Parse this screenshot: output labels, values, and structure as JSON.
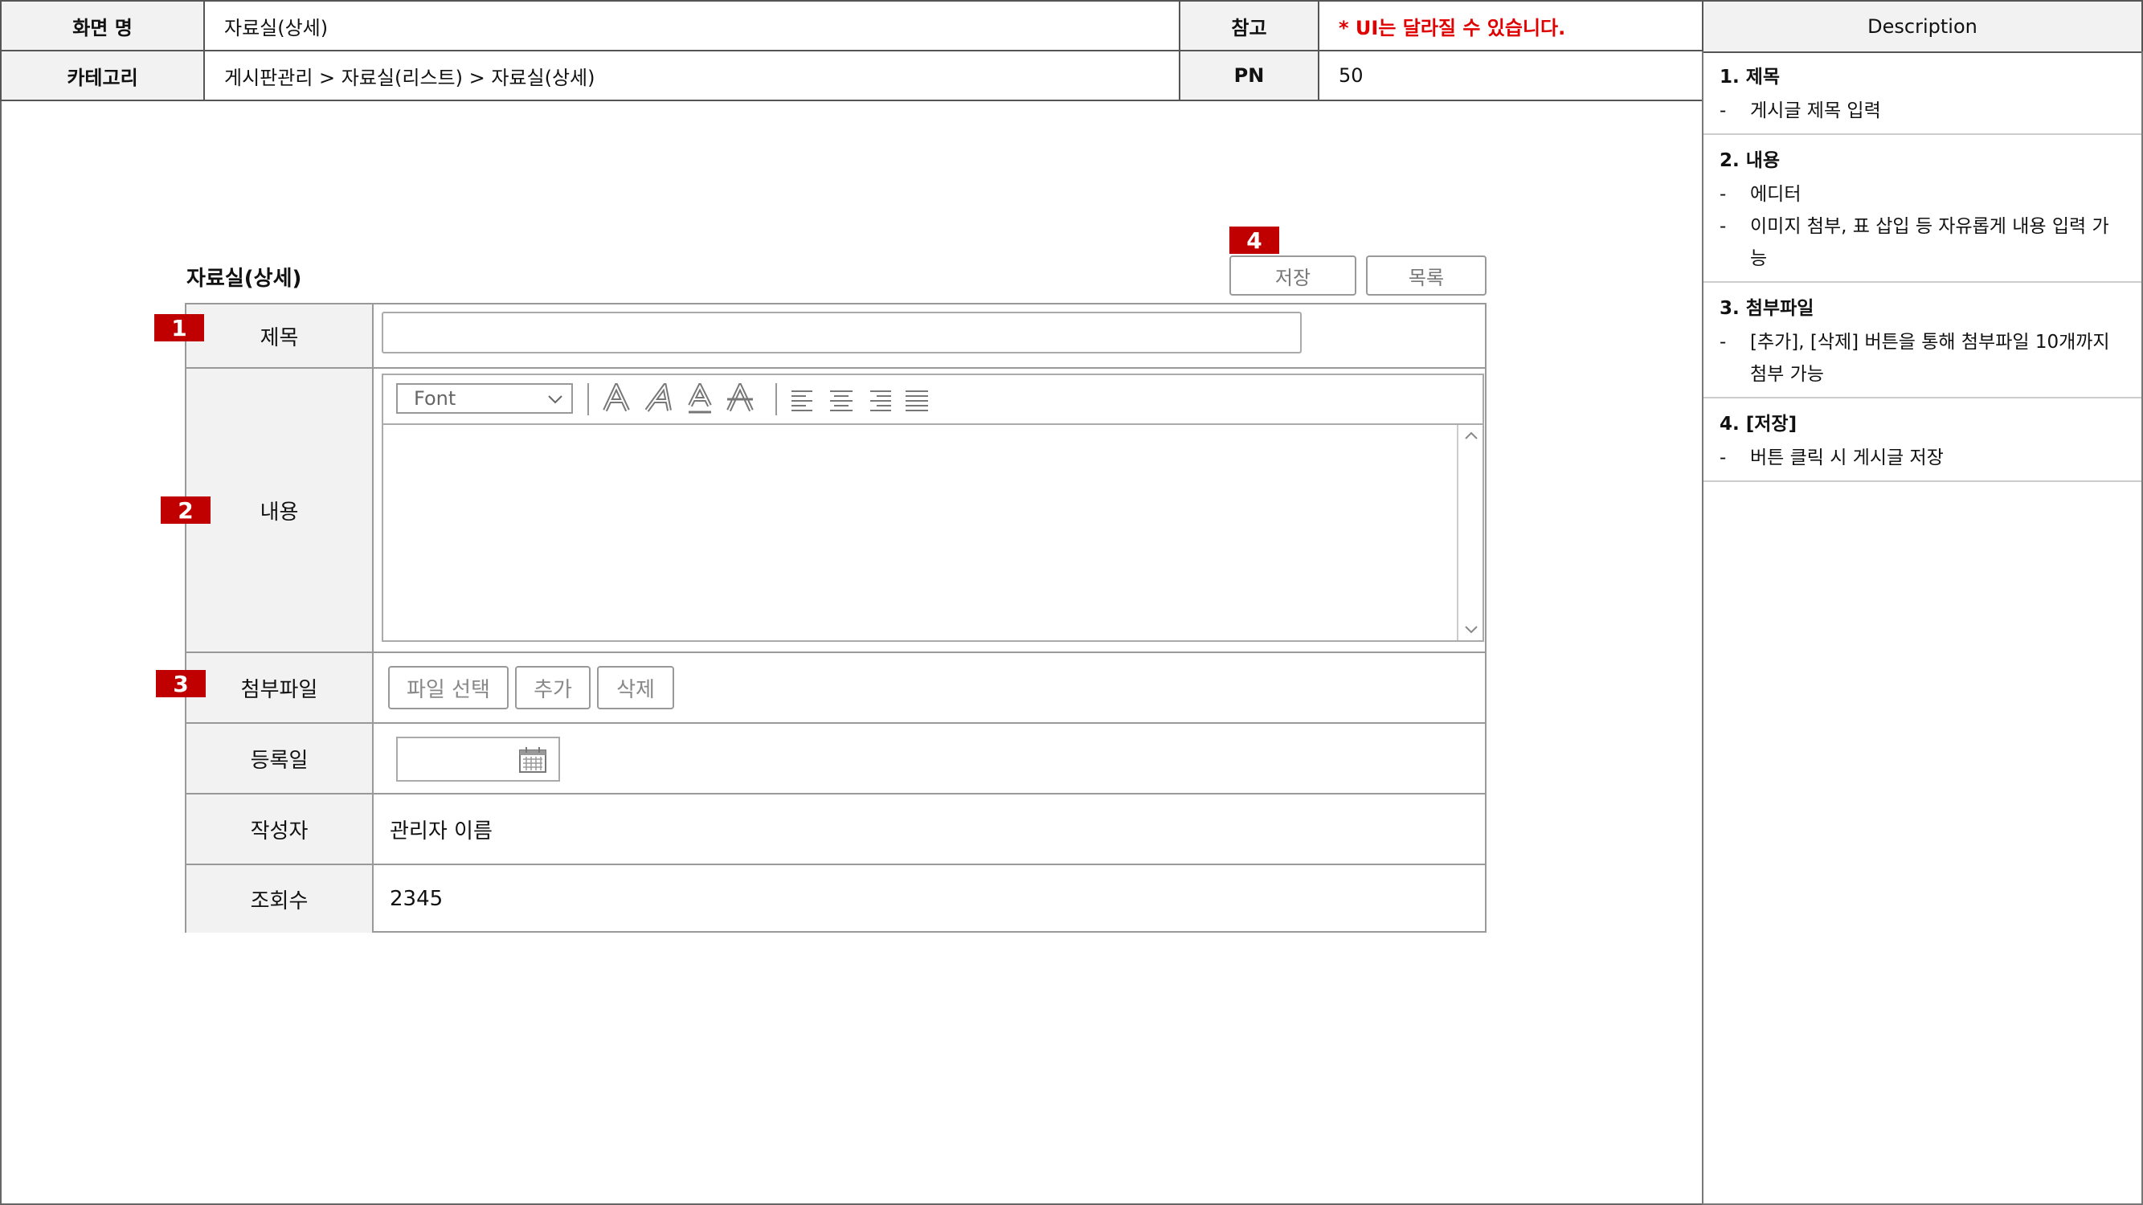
{
  "header": {
    "screen_name_label": "화면 명",
    "screen_name": "자료실(상세)",
    "ref_label": "참고",
    "ref_note": "* UI는 달라질 수 있습니다.",
    "category_label": "카테고리",
    "category": "게시판관리 > 자료실(리스트) > 자료실(상세)",
    "pn_label": "PN",
    "pn": "50"
  },
  "description": {
    "title": "Description",
    "items": [
      {
        "title": "1. 제목",
        "lines": [
          "게시글 제목 입력"
        ]
      },
      {
        "title": "2. 내용",
        "lines": [
          "에디터",
          "이미지 첨부, 표 삽입 등 자유롭게 내용 입력 가능"
        ]
      },
      {
        "title": "3. 첨부파일",
        "lines": [
          "[추가], [삭제] 버튼을 통해 첨부파일 10개까지 첨부 가능"
        ]
      },
      {
        "title": "4. [저장]",
        "lines": [
          "버튼 클릭 시 게시글 저장"
        ]
      }
    ]
  },
  "form": {
    "title": "자료실(상세)",
    "save_label": "저장",
    "list_label": "목록",
    "subject_label": "제목",
    "subject_value": "",
    "content_label": "내용",
    "font_select": "Font",
    "attach_label": "첨부파일",
    "file_select_label": "파일 선택",
    "add_label": "추가",
    "delete_label": "삭제",
    "date_label": "등록일",
    "date_value": "",
    "author_label": "작성자",
    "author_value": "관리자 이름",
    "views_label": "조회수",
    "views_value": "2345"
  },
  "badges": [
    "1",
    "2",
    "3",
    "4"
  ],
  "colors": {
    "badge": "#c00000",
    "note": "#e00000",
    "label_bg": "#f2f2f2",
    "border": "#999999"
  },
  "icons": [
    "chevron-down-icon",
    "bold-icon",
    "italic-icon",
    "underline-icon",
    "strikethrough-icon",
    "align-left-icon",
    "align-center-icon",
    "align-right-icon",
    "align-justify-icon",
    "scroll-up-icon",
    "scroll-down-icon",
    "calendar-icon"
  ]
}
